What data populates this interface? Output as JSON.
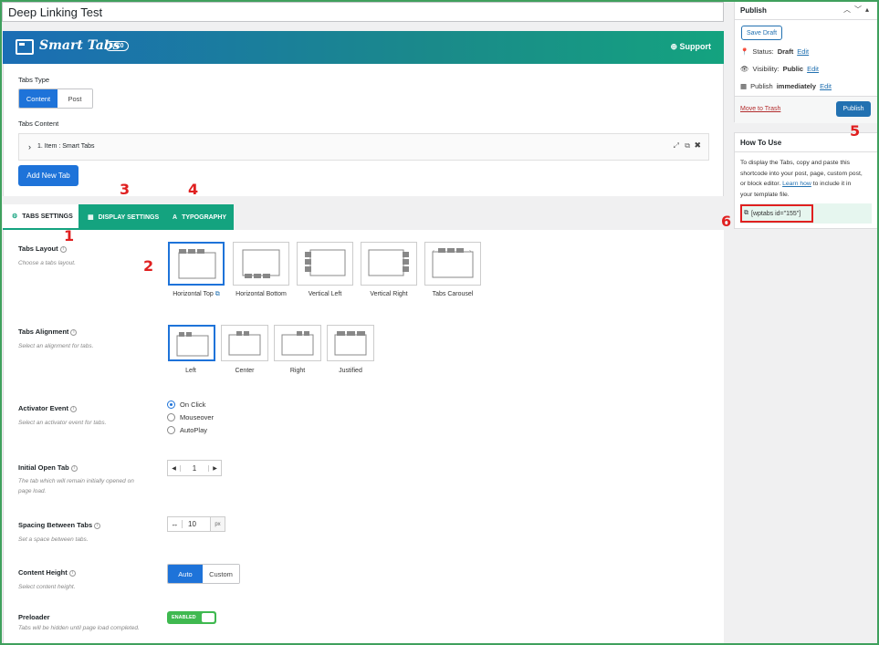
{
  "page_title": "Deep Linking Test",
  "header": {
    "brand": "Smart Tabs",
    "version": "3.0.0",
    "support_label": "Support"
  },
  "tabs_type": {
    "label": "Tabs Type",
    "options": [
      "Content",
      "Post"
    ],
    "selected": "Content"
  },
  "tabs_content": {
    "label": "Tabs Content",
    "item": "1. Item : Smart Tabs",
    "add_button": "Add New Tab"
  },
  "settings_tabs": [
    "TABS SETTINGS",
    "DISPLAY SETTINGS",
    "TYPOGRAPHY"
  ],
  "fields": {
    "layout": {
      "label": "Tabs Layout",
      "desc": "Choose a tabs layout.",
      "options": [
        "Horizontal Top",
        "Horizontal Bottom",
        "Vertical Left",
        "Vertical Right",
        "Tabs Carousel"
      ],
      "selected": "Horizontal Top"
    },
    "alignment": {
      "label": "Tabs Alignment",
      "desc": "Select an alignment for tabs.",
      "options": [
        "Left",
        "Center",
        "Right",
        "Justified"
      ],
      "selected": "Left"
    },
    "activator": {
      "label": "Activator Event",
      "desc": "Select an activator event for tabs.",
      "options": [
        "On Click",
        "Mouseover",
        "AutoPlay"
      ],
      "selected": "On Click"
    },
    "initial": {
      "label": "Initial Open Tab",
      "desc_1": "The tab which will remain initially opened on",
      "desc_2": "page load.",
      "value": "1"
    },
    "spacing": {
      "label": "Spacing Between Tabs",
      "desc": "Set a space between tabs.",
      "value": "10",
      "unit": "px"
    },
    "height": {
      "label": "Content Height",
      "desc": "Select content height.",
      "options": [
        "Auto",
        "Custom"
      ],
      "selected": "Auto"
    },
    "preloader": {
      "label": "Preloader",
      "desc": "Tabs will be hidden until page load completed.",
      "toggle": "ENABLED"
    }
  },
  "publish": {
    "title": "Publish",
    "save_draft": "Save Draft",
    "status_label": "Status:",
    "status_value": "Draft",
    "visibility_label": "Visibility:",
    "visibility_value": "Public",
    "schedule_label": "Publish",
    "schedule_value": "immediately",
    "edit": "Edit",
    "trash": "Move to Trash",
    "publish_button": "Publish"
  },
  "howto": {
    "title": "How To Use",
    "line1": "To display the Tabs, copy and paste this",
    "line2": "shortcode into your post, page, custom post,",
    "line3a": "or block editor.",
    "link": "Learn how",
    "line3b": "to include it in",
    "line4": "your template file.",
    "shortcode": "[wptabs id=\"155\"]"
  },
  "markers": [
    "1",
    "2",
    "3",
    "4",
    "5",
    "6"
  ],
  "colors": {
    "accent": "#1e73d9",
    "tab_green": "#14a37f",
    "marker_red": "#e02020",
    "toggle_green": "#3fb950"
  }
}
